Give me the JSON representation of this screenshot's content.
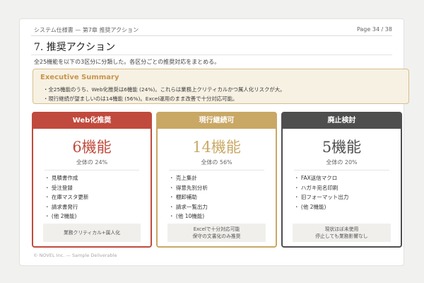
{
  "header": {
    "doc_title": "システム仕様書 — 第7章 推奨アクション",
    "page_label": "Page 34 / 38"
  },
  "section": {
    "title": "7. 推奨アクション",
    "intro": "全25機能を以下の3区分に分類した。各区分ごとの推奨対応をまとめる。"
  },
  "summary": {
    "title": "Executive Summary",
    "line1": "・全25機能のうち、Web化推奨は6機能 (24%)。これらは業務上クリティカルかつ属人化リスクが大。",
    "line2": "・現行継続が望ましいのは14機能 (56%)。Excel運用のまま改善で十分対応可能。"
  },
  "cards": [
    {
      "label": "Web化推奨",
      "count": "6機能",
      "share": "全体の 24%",
      "items": [
        "見積書作成",
        "受注登録",
        "在庫マスタ更新",
        "請求書発行",
        "(他 2機能)"
      ],
      "note_line1": "業務クリティカル+属人化",
      "note_line2": ""
    },
    {
      "label": "現行継続可",
      "count": "14機能",
      "share": "全体の 56%",
      "items": [
        "売上集計",
        "得意先別分析",
        "棚卸補助",
        "請求一覧出力",
        "(他 10機能)"
      ],
      "note_line1": "Excelで十分対応可能",
      "note_line2": "保守の文書化のみ推奨"
    },
    {
      "label": "廃止検討",
      "count": "5機能",
      "share": "全体の 20%",
      "items": [
        "FAX送信マクロ",
        "ハガキ宛名印刷",
        "旧フォーマット出力",
        "(他 2機能)"
      ],
      "note_line1": "現状ほぼ未使用",
      "note_line2": "停止しても業務影響なし"
    }
  ],
  "footer": {
    "text": "© NOVEL Inc. — Sample Deliverable"
  },
  "colors": {
    "web": "#c04a3d",
    "keep": "#c9a865",
    "retire": "#4e4e4e",
    "accent": "#c8944a"
  }
}
